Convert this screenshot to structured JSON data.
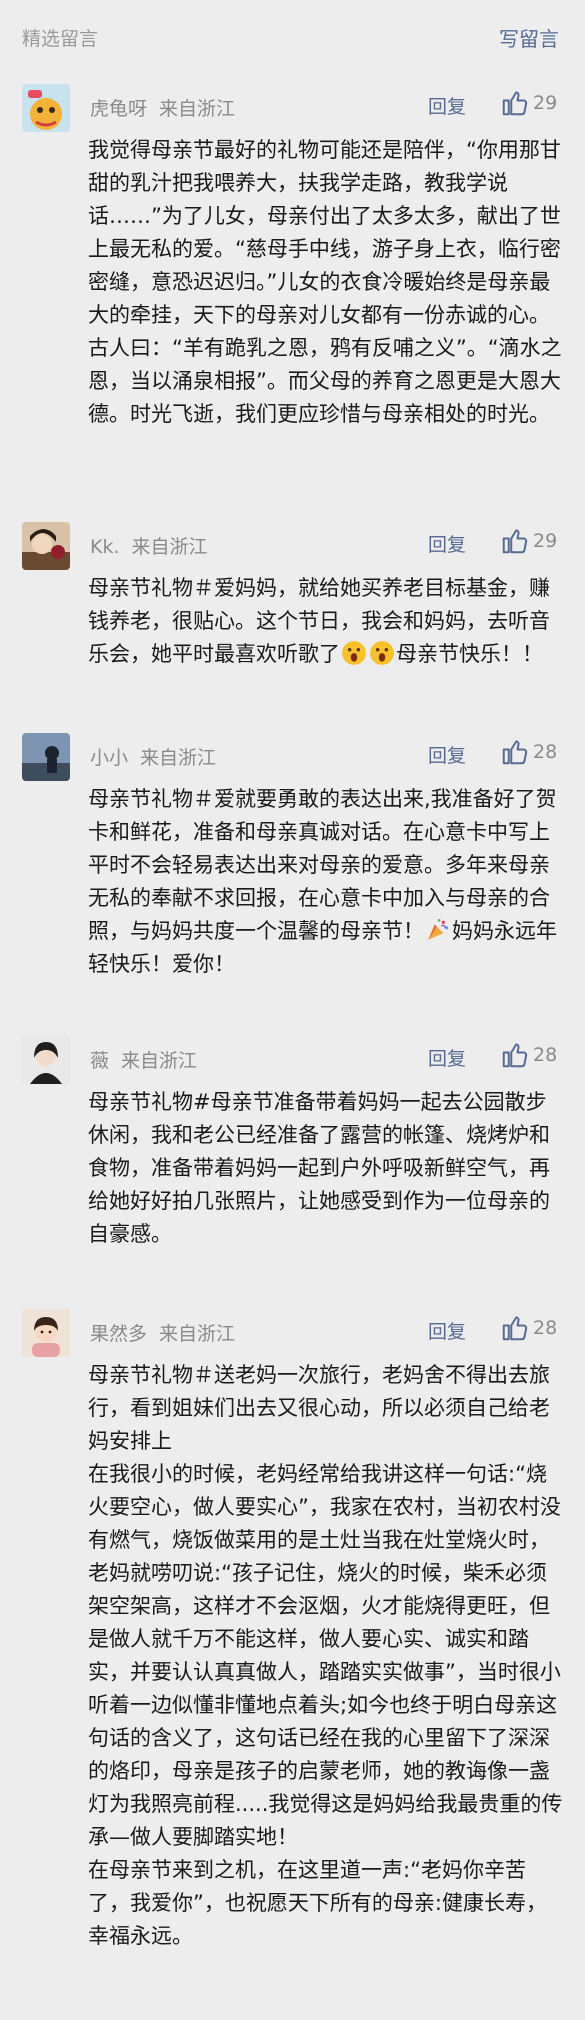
{
  "header": {
    "title": "精选留言",
    "write_label": "写留言"
  },
  "comments": [
    {
      "nickname": "虎龟呀",
      "location": "来自浙江",
      "reply": "回复",
      "likes": "29",
      "paragraphs": [
        "我觉得母亲节最好的礼物可能还是陪伴，“你用那甘甜的乳汁把我喂养大，扶我学走路，教我学说话……”为了儿女，母亲付出了太多太多，献出了世上最无私的爱。“慈母手中线，游子身上衣，临行密密缝，意恐迟迟归。”儿女的衣食冷暖始终是母亲最大的牵挂，天下的母亲对儿女都有一份赤诚的心。古人曰：“羊有跪乳之恩，鸦有反哺之义”。“滴水之恩，当以涌泉相报”。而父母的养育之恩更是大恩大德。时光飞逝，我们更应珍惜与母亲相处的时光。"
      ]
    },
    {
      "nickname": "Kk.",
      "location": "来自浙江",
      "reply": "回复",
      "likes": "29",
      "text_before": "母亲节礼物＃爱妈妈，就给她买养老目标基金，赚钱养老，很贴心。这个节日，我会和妈妈，去听音乐会，她平时最喜欢听歌了",
      "emoji": "surprised-face-emoji",
      "text_after": "母亲节快乐！！"
    },
    {
      "nickname": "小小",
      "location": "来自浙江",
      "reply": "回复",
      "likes": "28",
      "text_before": "母亲节礼物＃爱就要勇敢的表达出来,我准备好了贺卡和鲜花，准备和母亲真诚对话。在心意卡中写上平时不会轻易表达出来对母亲的爱意。多年来母亲无私的奉献不求回报，在心意卡中加入与母亲的合照，与妈妈共度一个温馨的母亲节！",
      "emoji": "party-popper-emoji",
      "text_after": "妈妈永远年轻快乐！爱你！"
    },
    {
      "nickname": "薇",
      "location": "来自浙江",
      "reply": "回复",
      "likes": "28",
      "paragraphs": [
        "母亲节礼物#母亲节准备带着妈妈一起去公园散步休闲，我和老公已经准备了露营的帐篷、烧烤炉和食物，准备带着妈妈一起到户外呼吸新鲜空气，再给她好好拍几张照片，让她感受到作为一位母亲的自豪感。"
      ]
    },
    {
      "nickname": "果然多",
      "location": "来自浙江",
      "reply": "回复",
      "likes": "28",
      "paragraphs": [
        "母亲节礼物＃送老妈一次旅行，老妈舍不得出去旅行，看到姐妹们出去又很心动，所以必须自己给老妈安排上",
        "在我很小的时候，老妈经常给我讲这样一句话:“烧火要空心，做人要实心”，我家在农村，当初农村没有燃气，烧饭做菜用的是土灶当我在灶堂烧火时，老妈就唠叨说:“孩子记住，烧火的时候，柴禾必须架空架高，这样才不会沤烟，火才能烧得更旺，但是做人就千万不能这样，做人要心实、诚实和踏实，并要认认真真做人，踏踏实实做事”，当时很小听着一边似懂非懂地点着头;如今也终于明白母亲这句话的含义了，这句话已经在我的心里留下了深深的烙印，母亲是孩子的启蒙老师，她的教诲像一盏灯为我照亮前程.....我觉得这是妈妈给我最贵重的传承—做人要脚踏实地！",
        "在母亲节来到之机，在这里道一声:“老妈你辛苦了，我爱你”，也祝愿天下所有的母亲:健康长寿，幸福永远。"
      ]
    }
  ]
}
